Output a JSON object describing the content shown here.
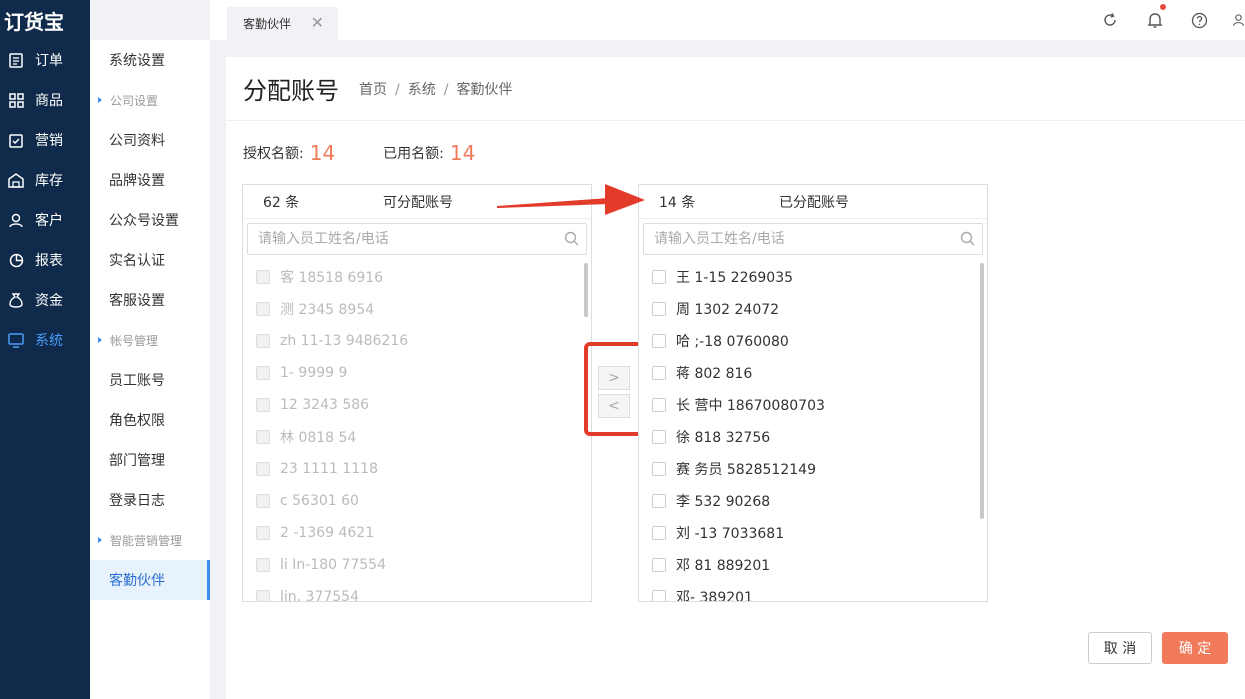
{
  "app": {
    "logo": "订货宝"
  },
  "nav": [
    {
      "label": "订单",
      "icon": "order-icon"
    },
    {
      "label": "商品",
      "icon": "goods-icon"
    },
    {
      "label": "营销",
      "icon": "marketing-icon"
    },
    {
      "label": "库存",
      "icon": "warehouse-icon"
    },
    {
      "label": "客户",
      "icon": "customer-icon"
    },
    {
      "label": "报表",
      "icon": "report-icon"
    },
    {
      "label": "资金",
      "icon": "money-icon"
    },
    {
      "label": "系统",
      "icon": "monitor-icon",
      "active": true
    }
  ],
  "submenu": {
    "system_settings": "系统设置",
    "group_company": "公司设置",
    "company_profile": "公司资料",
    "brand_settings": "品牌设置",
    "official_account": "公众号设置",
    "realname": "实名认证",
    "service_settings": "客服设置",
    "group_account": "帐号管理",
    "staff_account": "员工账号",
    "role_permission": "角色权限",
    "dept_manage": "部门管理",
    "login_log": "登录日志",
    "group_smart": "智能营销管理",
    "partner": "客勤伙伴"
  },
  "topbar": {
    "tab_label": "客勤伙伴",
    "tab_close": "✕"
  },
  "page": {
    "title": "分配账号",
    "breadcrumb": [
      "首页",
      "系统",
      "客勤伙伴"
    ],
    "sep": "/",
    "quota_label": "授权名额:",
    "quota_value": "14",
    "used_label": "已用名额:",
    "used_value": "14"
  },
  "left_box": {
    "count": "62 条",
    "title": "可分配账号",
    "placeholder": "请输入员工姓名/电话",
    "items": [
      "客   18518   6916",
      "测   2345   8954",
      "zh   11-13   9486216",
      "1-   9999   9",
      "12   3243   586",
      "林   0818   54",
      "23   1111   1118",
      "c   56301   60",
      "2   -1369   4621",
      "li   In-180   77554",
      "lin.   377554"
    ]
  },
  "right_box": {
    "count": "14 条",
    "title": "已分配账号",
    "placeholder": "请输入员工姓名/电话",
    "items": [
      "王   1-15   2269035",
      "周   1302   24072",
      "哈   ;-18   0760080",
      "蒋   802   816",
      "长   营中   18670080703",
      "徐   818   32756",
      "赛   务员   5828512149",
      "李   532   90268",
      "刘   -13   7033681",
      "邓   81   889201",
      "邓-   389201"
    ]
  },
  "transfer": {
    "to_right": ">",
    "to_left": "<"
  },
  "actions": {
    "cancel": "取 消",
    "ok": "确 定"
  },
  "colors": {
    "nav_bg": "#0f2a4a",
    "accent": "#f07a5a",
    "active_blue": "#3b8ef0",
    "highlight_red": "#e23b2a"
  }
}
